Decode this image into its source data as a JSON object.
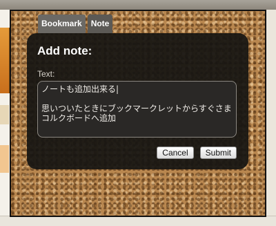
{
  "tabs": [
    {
      "label": "Bookmark",
      "active": false
    },
    {
      "label": "Note",
      "active": true
    }
  ],
  "dialog": {
    "title": "Add note:",
    "text_label": "Text:",
    "text_value": "ノートも追加出来る|\n\n思いついたときにブックマークレットからすぐさまコルクボードへ追加",
    "cancel_label": "Cancel",
    "submit_label": "Submit"
  }
}
